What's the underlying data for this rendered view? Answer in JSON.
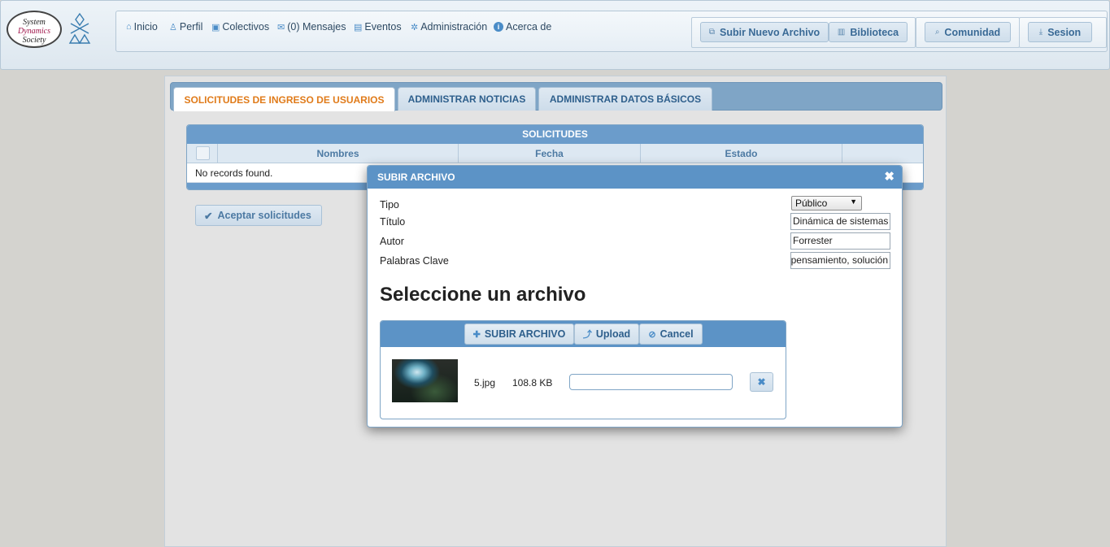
{
  "header": {
    "logo_lines": [
      "System",
      "Dynamics",
      "Society"
    ],
    "nav": [
      {
        "label": "Inicio",
        "icon": "home-icon"
      },
      {
        "label": "Perfil",
        "icon": "user-icon"
      },
      {
        "label": "Colectivos",
        "icon": "group-icon"
      },
      {
        "label": "(0) Mensajes",
        "icon": "mail-icon"
      },
      {
        "label": "Eventos",
        "icon": "calendar-icon"
      },
      {
        "label": "Administración",
        "icon": "gear-icon"
      },
      {
        "label": "Acerca de",
        "icon": "info-icon"
      }
    ],
    "buttons": {
      "upload": "Subir Nuevo Archivo",
      "library": "Biblioteca",
      "community": "Comunidad",
      "session": "Sesion"
    }
  },
  "tabs": [
    {
      "label": "SOLICITUDES DE INGRESO DE USUARIOS",
      "active": true
    },
    {
      "label": "ADMINISTRAR NOTICIAS",
      "active": false
    },
    {
      "label": "ADMINISTRAR DATOS BÁSICOS",
      "active": false
    }
  ],
  "grid": {
    "title": "SOLICITUDES",
    "columns": [
      "Nombres",
      "Fecha",
      "Estado"
    ],
    "empty_message": "No records found."
  },
  "accept_button": "Aceptar solicitudes",
  "dialog": {
    "title": "SUBIR ARCHIVO",
    "fields": {
      "tipo": {
        "label": "Tipo",
        "value": "Público"
      },
      "titulo": {
        "label": "Título",
        "value": "Dinámica de sistemas"
      },
      "autor": {
        "label": "Autor",
        "value": "Forrester"
      },
      "keywords": {
        "label": "Palabras Clave",
        "value": "ds, pensamiento, solución"
      }
    },
    "heading": "Seleccione un archivo",
    "uploader": {
      "choose_label": "SUBIR ARCHIVO",
      "upload_label": "Upload",
      "cancel_label": "Cancel",
      "file": {
        "name": "5.jpg",
        "size": "108.8 KB",
        "progress": 0
      }
    }
  },
  "colors": {
    "accent": "#5c93c6",
    "active_tab_text": "#e07b1a",
    "page_bg": "#d4d3cf"
  }
}
